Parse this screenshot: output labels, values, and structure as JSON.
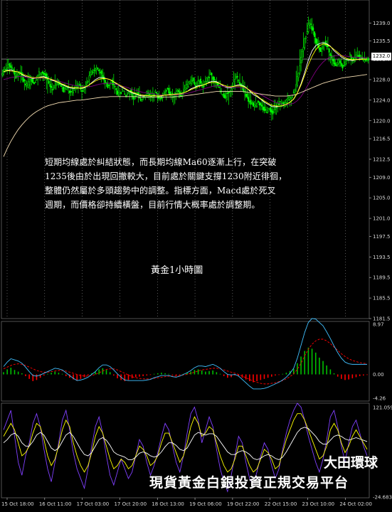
{
  "chart_data": [
    {
      "type": "line",
      "title": "黃金1小時圖",
      "annotation": "短期均線處於糾結狀態，而長期均線Ma60逐漸上行，在突破1235後由於出現回撤較大，目前處於關鍵支撐1230附近徘徊，整體仍然屬於多頭趨勢中的調整。指標方面，Macd處於死叉週期，而價格卻持續橫盤，目前行情大概率處於調整期。",
      "annotation_lines": [
        "短期均線處於糾結狀態，而長期均線Ma60逐漸上行，在突破",
        "1235後由於出現回撤較大，目前處於關鍵支撐1230附近徘徊，",
        "整體仍然屬於多頭趨勢中的調整。指標方面，Macd處於死叉",
        "週期，而價格卻持續橫盤，目前行情大概率處於調整期。"
      ],
      "current_price": "1232.0",
      "y_ticks": [
        "1239.0",
        "1235.5",
        "1232.0",
        "1228.0",
        "1224.0",
        "1220.0",
        "1216.5",
        "1212.5",
        "1209.0",
        "1205.0",
        "1201.0",
        "1197.5",
        "1193.5",
        "1189.5",
        "1185.5",
        "1181.5"
      ],
      "ylim": [
        1181.5,
        1241
      ],
      "x_ticks": [
        "15 Oct 18:00",
        "16 Oct 11:00",
        "17 Oct 03:00",
        "17 Oct 20:00",
        "18 Oct 13:00",
        "19 Oct 06:00",
        "19 Oct 22:00",
        "22 Oct 15:00",
        "23 Oct 10:00",
        "24 Oct 02:00"
      ],
      "series": [
        {
          "values": [
            1229.8,
            1231.0,
            1230.2,
            1228.5,
            1229.6,
            1227.9,
            1226.8,
            1228.4,
            1227.2,
            1229.0,
            1229.6,
            1228.8,
            1227.0,
            1226.2,
            1227.8,
            1227.0,
            1225.9,
            1226.6,
            1225.2,
            1226.4,
            1227.1,
            1225.8,
            1226.9,
            1228.6,
            1229.8,
            1230.6,
            1229.4,
            1228.0,
            1226.8,
            1227.6,
            1226.4,
            1225.0,
            1225.8,
            1224.8,
            1225.6,
            1224.4,
            1225.2,
            1224.0,
            1224.8,
            1225.6,
            1224.6,
            1225.4,
            1224.2,
            1225.0,
            1226.2,
            1225.4,
            1224.6,
            1225.8,
            1224.8,
            1226.4,
            1227.0,
            1228.2,
            1226.8,
            1227.8,
            1226.6,
            1228.0,
            1229.0,
            1227.8,
            1226.6,
            1225.4,
            1224.6,
            1225.8,
            1226.8,
            1228.6,
            1227.4,
            1226.0,
            1224.4,
            1223.4,
            1222.8,
            1223.8,
            1222.6,
            1221.8,
            1222.4,
            1221.6,
            1222.8,
            1223.6,
            1223.0,
            1224.2,
            1224.8,
            1226.0,
            1229.5,
            1233.5,
            1236.8,
            1239.2,
            1237.4,
            1234.6,
            1233.6,
            1235.4,
            1234.0,
            1232.2,
            1230.8,
            1231.6,
            1230.4,
            1231.6,
            1232.6,
            1231.8,
            1233.0,
            1232.2,
            1231.6,
            1232.0
          ]
        },
        {
          "values": [
            1229.5,
            1229.8,
            1229.9,
            1229.6,
            1229.5,
            1229.0,
            1228.6,
            1228.4,
            1228.2,
            1228.3,
            1228.5,
            1228.6,
            1228.3,
            1227.9,
            1227.7,
            1227.4,
            1227.0,
            1226.7,
            1226.4,
            1226.3,
            1226.4,
            1226.3,
            1226.4,
            1226.8,
            1227.4,
            1228.0,
            1228.4,
            1228.4,
            1228.2,
            1228.0,
            1227.6,
            1227.0,
            1226.6,
            1226.2,
            1225.8,
            1225.4,
            1225.2,
            1224.9,
            1224.8,
            1224.9,
            1224.8,
            1224.9,
            1224.8,
            1224.8,
            1225.0,
            1225.1,
            1225.1,
            1225.2,
            1225.2,
            1225.4,
            1225.7,
            1226.2,
            1226.5,
            1226.8,
            1226.9,
            1227.1,
            1227.5,
            1227.7,
            1227.6,
            1227.2,
            1226.7,
            1226.4,
            1226.4,
            1226.8,
            1227.0,
            1226.9,
            1226.5,
            1225.8,
            1225.1,
            1224.7,
            1224.2,
            1223.6,
            1223.2,
            1222.8,
            1222.7,
            1222.8,
            1222.9,
            1223.2,
            1223.6,
            1224.2,
            1225.4,
            1227.2,
            1229.4,
            1231.8,
            1233.6,
            1234.6,
            1235.0,
            1235.2,
            1235.0,
            1234.5,
            1233.6,
            1233.0,
            1232.4,
            1232.0,
            1231.8,
            1231.7,
            1231.9,
            1232.0,
            1232.0,
            1232.0
          ]
        },
        {
          "values": [
            1228.0,
            1228.2,
            1228.4,
            1228.5,
            1228.6,
            1228.6,
            1228.5,
            1228.4,
            1228.3,
            1228.3,
            1228.3,
            1228.3,
            1228.2,
            1228.0,
            1227.9,
            1227.7,
            1227.5,
            1227.3,
            1227.1,
            1226.9,
            1226.8,
            1226.7,
            1226.6,
            1226.6,
            1226.7,
            1226.9,
            1227.1,
            1227.2,
            1227.3,
            1227.3,
            1227.2,
            1227.0,
            1226.8,
            1226.6,
            1226.4,
            1226.1,
            1225.9,
            1225.7,
            1225.5,
            1225.4,
            1225.3,
            1225.2,
            1225.1,
            1225.0,
            1225.0,
            1225.0,
            1225.0,
            1225.0,
            1225.1,
            1225.2,
            1225.3,
            1225.5,
            1225.7,
            1225.9,
            1226.1,
            1226.3,
            1226.5,
            1226.7,
            1226.8,
            1226.8,
            1226.7,
            1226.6,
            1226.5,
            1226.5,
            1226.5,
            1226.4,
            1226.3,
            1226.0,
            1225.7,
            1225.4,
            1225.1,
            1224.7,
            1224.3,
            1223.9,
            1223.6,
            1223.4,
            1223.2,
            1223.1,
            1223.2,
            1223.4,
            1223.9,
            1224.7,
            1225.8,
            1227.1,
            1228.4,
            1229.6,
            1230.6,
            1231.4,
            1232.0,
            1232.4,
            1232.6,
            1232.7,
            1232.7,
            1232.6,
            1232.5,
            1232.4,
            1232.4,
            1232.3,
            1232.3,
            1232.2
          ]
        },
        {
          "values": [
            1213.0,
            1214.6,
            1216.0,
            1217.2,
            1218.3,
            1219.2,
            1220.0,
            1220.7,
            1221.3,
            1221.8,
            1222.2,
            1222.6,
            1222.9,
            1223.1,
            1223.3,
            1223.5,
            1223.6,
            1223.7,
            1223.8,
            1223.9,
            1224.0,
            1224.0,
            1224.1,
            1224.2,
            1224.3,
            1224.4,
            1224.5,
            1224.6,
            1224.6,
            1224.7,
            1224.7,
            1224.7,
            1224.7,
            1224.7,
            1224.7,
            1224.7,
            1224.7,
            1224.6,
            1224.6,
            1224.6,
            1224.6,
            1224.6,
            1224.6,
            1224.6,
            1224.6,
            1224.6,
            1224.6,
            1224.7,
            1224.7,
            1224.8,
            1224.9,
            1225.0,
            1225.1,
            1225.2,
            1225.3,
            1225.4,
            1225.5,
            1225.6,
            1225.7,
            1225.7,
            1225.7,
            1225.7,
            1225.7,
            1225.7,
            1225.7,
            1225.7,
            1225.6,
            1225.5,
            1225.4,
            1225.3,
            1225.2,
            1225.1,
            1225.0,
            1224.9,
            1224.8,
            1224.8,
            1224.8,
            1224.8,
            1224.9,
            1225.0,
            1225.2,
            1225.5,
            1225.8,
            1226.1,
            1226.4,
            1226.7,
            1227.0,
            1227.3,
            1227.5,
            1227.7,
            1227.9,
            1228.1,
            1228.3,
            1228.4,
            1228.5,
            1228.6,
            1228.7,
            1228.8,
            1228.9,
            1229.0
          ]
        }
      ]
    },
    {
      "type": "bar",
      "y_ticks": [
        "8.97",
        "0.00",
        "-4.26"
      ],
      "ylim": [
        -4.26,
        8.97
      ],
      "histogram": [
        0.4,
        0.9,
        1.2,
        0.8,
        0.5,
        0.2,
        -0.3,
        -0.8,
        -1.2,
        -1.0,
        -0.6,
        -0.2,
        0.1,
        0.3,
        0.5,
        0.3,
        0.1,
        -0.3,
        -0.6,
        -0.9,
        -1.1,
        -0.8,
        -0.5,
        -0.2,
        0.2,
        0.5,
        0.9,
        1.1,
        0.8,
        0.4,
        -0.2,
        -0.7,
        -1.0,
        -1.2,
        -1.0,
        -0.7,
        -0.5,
        -0.4,
        -0.3,
        -0.2,
        -0.1,
        0.1,
        0.2,
        0.3,
        0.2,
        0.1,
        -0.1,
        -0.2,
        -0.1,
        0.1,
        0.3,
        0.5,
        0.8,
        0.9,
        0.7,
        0.5,
        0.6,
        0.7,
        0.4,
        0.1,
        -0.3,
        -0.6,
        -0.5,
        -0.2,
        -0.3,
        -0.6,
        -0.9,
        -1.2,
        -1.4,
        -1.2,
        -1.0,
        -0.8,
        -0.6,
        -0.4,
        -0.2,
        -0.1,
        0.1,
        0.3,
        0.6,
        1.0,
        2.0,
        3.2,
        4.2,
        4.8,
        4.6,
        3.9,
        3.0,
        2.4,
        1.6,
        0.9,
        0.2,
        -0.4,
        -0.8,
        -1.0,
        -0.9,
        -0.7,
        -0.5,
        -0.3,
        -0.2,
        -0.1
      ],
      "signal": [
        1.0,
        1.3,
        1.6,
        1.8,
        1.9,
        1.8,
        1.6,
        1.3,
        1.0,
        0.7,
        0.5,
        0.4,
        0.4,
        0.5,
        0.6,
        0.7,
        0.7,
        0.6,
        0.4,
        0.2,
        0.0,
        -0.2,
        -0.3,
        -0.3,
        -0.2,
        0.0,
        0.3,
        0.6,
        0.9,
        1.0,
        1.0,
        0.8,
        0.5,
        0.2,
        -0.1,
        -0.4,
        -0.6,
        -0.7,
        -0.8,
        -0.8,
        -0.8,
        -0.7,
        -0.6,
        -0.5,
        -0.4,
        -0.3,
        -0.3,
        -0.3,
        -0.2,
        -0.1,
        0.0,
        0.2,
        0.4,
        0.6,
        0.8,
        0.9,
        1.0,
        1.1,
        1.1,
        1.0,
        0.8,
        0.6,
        0.4,
        0.2,
        0.0,
        -0.3,
        -0.6,
        -0.9,
        -1.2,
        -1.4,
        -1.6,
        -1.7,
        -1.7,
        -1.6,
        -1.5,
        -1.3,
        -1.1,
        -0.8,
        -0.4,
        0.1,
        0.9,
        2.0,
        3.3,
        4.5,
        5.4,
        6.0,
        6.3,
        6.3,
        6.0,
        5.5,
        4.9,
        4.3,
        3.7,
        3.2,
        2.8,
        2.5,
        2.3,
        2.1,
        2.0,
        1.9
      ],
      "macd": [
        1.4,
        2.2,
        2.8,
        2.6,
        2.4,
        2.0,
        1.3,
        0.5,
        -0.2,
        -0.3,
        -0.1,
        0.2,
        0.5,
        0.8,
        1.1,
        1.0,
        0.8,
        0.3,
        -0.2,
        -0.7,
        -1.1,
        -1.0,
        -0.8,
        -0.5,
        0.0,
        0.5,
        1.2,
        1.7,
        1.7,
        1.4,
        0.8,
        0.1,
        -0.5,
        -1.0,
        -1.1,
        -1.1,
        -1.1,
        -1.1,
        -1.1,
        -1.0,
        -0.9,
        -0.6,
        -0.4,
        -0.2,
        -0.2,
        -0.2,
        -0.4,
        -0.5,
        -0.3,
        0.0,
        0.3,
        0.7,
        1.2,
        1.5,
        1.5,
        1.4,
        1.6,
        1.8,
        1.5,
        1.1,
        0.5,
        0.0,
        -0.1,
        0.0,
        -0.3,
        -0.9,
        -1.5,
        -2.1,
        -2.6,
        -2.6,
        -2.6,
        -2.5,
        -2.3,
        -2.0,
        -1.7,
        -1.4,
        -1.0,
        -0.5,
        0.2,
        1.1,
        2.9,
        5.2,
        7.5,
        9.3,
        10.0,
        9.9,
        9.3,
        8.7,
        7.6,
        6.4,
        5.1,
        3.9,
        2.9,
        2.2,
        1.9,
        1.8,
        1.8,
        1.8,
        1.8,
        1.8
      ]
    },
    {
      "type": "line",
      "y_ticks": [
        "121.059",
        "-24.6836"
      ],
      "ylim": [
        -24.6836,
        121.059
      ],
      "series": [
        {
          "values": [
            80,
            95,
            110,
            70,
            30,
            10,
            40,
            60,
            90,
            105,
            85,
            50,
            20,
            0,
            30,
            60,
            95,
            110,
            80,
            45,
            20,
            5,
            -10,
            20,
            55,
            85,
            100,
            75,
            40,
            10,
            -5,
            15,
            35,
            20,
            5,
            15,
            40,
            65,
            55,
            30,
            10,
            25,
            45,
            70,
            90,
            80,
            55,
            30,
            15,
            40,
            75,
            105,
            115,
            95,
            60,
            80,
            100,
            85,
            50,
            20,
            0,
            -15,
            10,
            40,
            70,
            60,
            30,
            5,
            -5,
            15,
            40,
            60,
            50,
            25,
            5,
            20,
            50,
            75,
            95,
            110,
            121,
            115,
            95,
            70,
            50,
            30,
            15,
            35,
            65,
            100,
            110,
            85,
            55,
            30,
            60,
            85,
            95,
            75,
            55,
            40
          ]
        },
        {
          "values": [
            70,
            80,
            90,
            80,
            60,
            40,
            45,
            55,
            75,
            90,
            85,
            65,
            40,
            25,
            35,
            55,
            80,
            95,
            85,
            60,
            40,
            25,
            15,
            25,
            45,
            70,
            85,
            75,
            55,
            35,
            20,
            25,
            35,
            30,
            20,
            25,
            40,
            55,
            50,
            40,
            25,
            30,
            40,
            60,
            75,
            75,
            60,
            45,
            30,
            40,
            60,
            85,
            100,
            90,
            70,
            75,
            85,
            80,
            60,
            40,
            25,
            15,
            20,
            35,
            55,
            55,
            40,
            25,
            15,
            20,
            35,
            50,
            45,
            35,
            20,
            25,
            45,
            65,
            80,
            95,
            105,
            105,
            95,
            80,
            65,
            50,
            35,
            40,
            55,
            80,
            90,
            80,
            60,
            45,
            55,
            70,
            80,
            70,
            60,
            50
          ]
        },
        {
          "values": [
            60,
            65,
            72,
            75,
            70,
            60,
            55,
            55,
            62,
            72,
            76,
            72,
            62,
            52,
            48,
            52,
            62,
            72,
            76,
            70,
            60,
            50,
            42,
            40,
            45,
            55,
            65,
            68,
            64,
            56,
            46,
            42,
            40,
            38,
            34,
            34,
            38,
            44,
            46,
            44,
            40,
            38,
            40,
            46,
            54,
            60,
            60,
            56,
            50,
            48,
            52,
            62,
            72,
            76,
            74,
            72,
            74,
            74,
            70,
            62,
            54,
            46,
            42,
            42,
            46,
            48,
            46,
            42,
            36,
            34,
            36,
            40,
            42,
            40,
            36,
            34,
            38,
            46,
            56,
            66,
            76,
            82,
            84,
            82,
            76,
            70,
            62,
            58,
            58,
            64,
            70,
            72,
            70,
            66,
            64,
            66,
            68,
            66,
            64,
            62
          ]
        }
      ]
    }
  ],
  "watermark": {
    "line1": "大田環球",
    "line2": "現貨黃金白銀投資正規交易平台"
  },
  "colors": {
    "background": "#000000",
    "candle_up": "#00ff00",
    "candle_down": "#00ff00",
    "ma_short": "#ffffff",
    "ma_mid": "#ffff00",
    "ma_long": "#800080",
    "ma60": "#f5deb3",
    "grid": "#ffffff",
    "macd_hist_pos": "#00c000",
    "macd_hist_neg": "#ff0000",
    "macd_signal": "#ff0000",
    "macd_line": "#40c0ff",
    "osc_purple": "#8040ff",
    "osc_yellow": "#ffff00",
    "osc_white": "#ffffff"
  }
}
